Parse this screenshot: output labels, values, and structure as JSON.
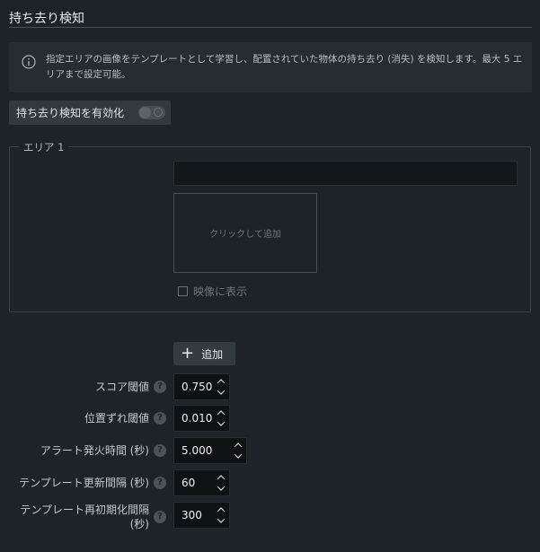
{
  "header": {
    "title": "持ち去り検知"
  },
  "info": {
    "icon": "info-circle-icon",
    "text": "指定エリアの画像をテンプレートとして学習し、配置されていた物体の持ち去り (消失) を検知します。最大 5 エリアまで設定可能。"
  },
  "enable": {
    "label": "持ち去り検知を有効化",
    "enabled": false
  },
  "area": {
    "legend": "エリア 1",
    "name_value": "",
    "click_add_label": "クリックして追加",
    "show_video_label": "映像に表示",
    "show_video_checked": false
  },
  "add_button": {
    "label": "追加",
    "icon": "plus-icon"
  },
  "settings": [
    {
      "label": "スコア閾値",
      "value": "0.750"
    },
    {
      "label": "位置ずれ閾値",
      "value": "0.010"
    },
    {
      "label": "アラート発火時間 (秒)",
      "value": "5.000"
    },
    {
      "label": "テンプレート更新間隔 (秒)",
      "value": "60"
    },
    {
      "label": "テンプレート再初期化間隔 (秒)",
      "value": "300"
    }
  ],
  "help_icon": "?"
}
